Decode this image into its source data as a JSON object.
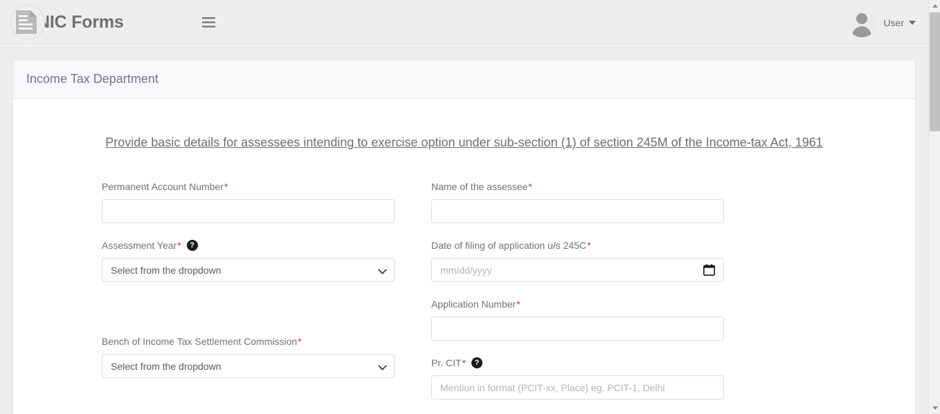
{
  "navbar": {
    "brand_name": "NIC Forms",
    "brand_logo_icon": "document-form-icon",
    "menu_toggle_icon": "hamburger-menu-icon",
    "avatar_icon": "user-avatar-icon",
    "user_label": "User",
    "caret_icon": "caret-down-icon"
  },
  "card": {
    "header_title": "Income Tax Department",
    "form_title": "Provide basic details for assessees intending to exercise option under sub-section (1) of section 245M of the Income-tax Act, 1961"
  },
  "form": {
    "required_marker": "*",
    "help_glyph": "?",
    "fields": {
      "pan": {
        "label": "Permanent Account Number",
        "required": "*",
        "value": "",
        "placeholder": ""
      },
      "assessee_name": {
        "label": "Name of the assessee",
        "required": "*",
        "value": "",
        "placeholder": ""
      },
      "assessment_year": {
        "label": "Assessment Year",
        "required": "*",
        "help_icon": "help-circle-icon",
        "selected": "Select from the dropdown",
        "options": [
          "Select from the dropdown"
        ]
      },
      "date_of_filing": {
        "label": "Date of filing of application u/s 245C",
        "required": "*",
        "value": "",
        "placeholder": "mm/dd/yyyy",
        "calendar_icon": "calendar-icon"
      },
      "application_number": {
        "label": "Application Number",
        "required": "*",
        "value": "",
        "placeholder": ""
      },
      "bench": {
        "label": "Bench of Income Tax Settlement Commission",
        "required": "*",
        "selected": "Select from the dropdown",
        "options": [
          "Select from the dropdown"
        ]
      },
      "pr_cit": {
        "label": "Pr. CIT ",
        "required": "*",
        "help_icon": "help-circle-icon",
        "value": "",
        "placeholder": "Mention in format (PCIT-xx, Place) eg. PCIT-1, Delhi"
      }
    }
  },
  "scrollbar": {
    "up_arrow_icon": "scroll-up-arrow-icon",
    "down_arrow_icon": "scroll-down-arrow-icon"
  },
  "colors": {
    "navbar_bg": "#eeeeee",
    "page_bg": "#ededed",
    "card_bg": "#ffffff",
    "card_header_bg": "#f7f8f9",
    "required_red": "#c0392b",
    "text_gray": "#6d7277"
  }
}
